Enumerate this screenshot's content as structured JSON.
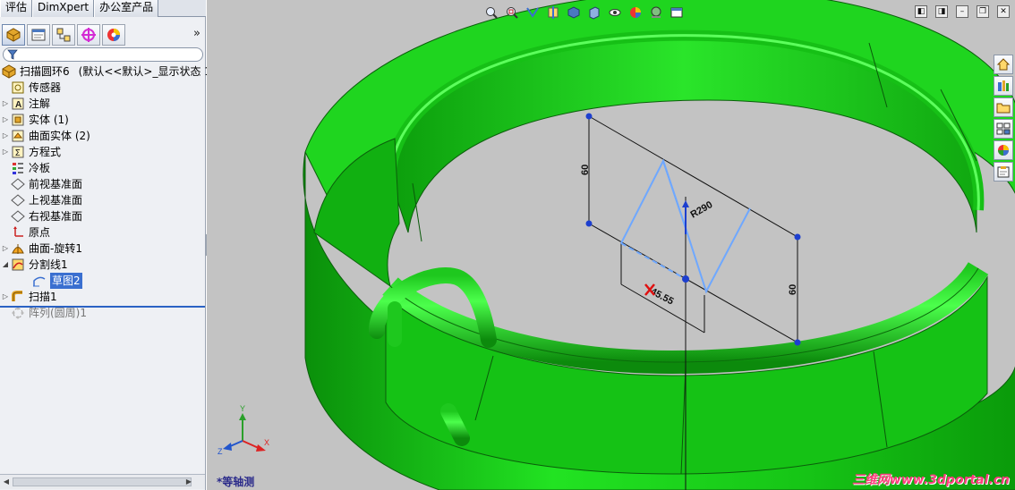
{
  "command_tabs": [
    "评估",
    "DimXpert",
    "办公室产品"
  ],
  "property_manager_tabs": [
    {
      "icon": "feature-manager-icon",
      "active": true
    },
    {
      "icon": "property-manager-icon",
      "active": false
    },
    {
      "icon": "configuration-manager-icon",
      "active": false
    },
    {
      "icon": "dimxpert-manager-icon",
      "active": false
    },
    {
      "icon": "display-manager-icon",
      "active": false
    }
  ],
  "tree": {
    "root": {
      "label": "扫描圆环6",
      "config": "(默认<<默认>_显示状态 1"
    },
    "items": [
      {
        "label": "传感器",
        "icon": "sensor-icon",
        "expandable": false
      },
      {
        "label": "注解",
        "icon": "annotation-icon",
        "expandable": true
      },
      {
        "label": "实体 (1)",
        "icon": "solid-body-icon",
        "expandable": true
      },
      {
        "label": "曲面实体 (2)",
        "icon": "surface-body-icon",
        "expandable": true
      },
      {
        "label": "方程式",
        "icon": "equation-icon",
        "expandable": true
      },
      {
        "label": "冷板",
        "icon": "material-icon",
        "expandable": false
      },
      {
        "label": "前视基准面",
        "icon": "plane-icon",
        "expandable": false
      },
      {
        "label": "上视基准面",
        "icon": "plane-icon",
        "expandable": false
      },
      {
        "label": "右视基准面",
        "icon": "plane-icon",
        "expandable": false
      },
      {
        "label": "原点",
        "icon": "origin-icon",
        "expandable": false
      },
      {
        "label": "曲面-旋转1",
        "icon": "revolve-surface-icon",
        "expandable": true
      },
      {
        "label": "分割线1",
        "icon": "split-line-icon",
        "expandable": true,
        "expanded": true
      },
      {
        "label": "草图2",
        "icon": "sketch-icon",
        "child": true,
        "selected": true
      },
      {
        "label": "扫描1",
        "icon": "sweep-icon",
        "expandable": true
      },
      {
        "label": "阵列(圆周)1",
        "icon": "circular-pattern-icon",
        "expandable": false,
        "grayed": true
      }
    ]
  },
  "viewport": {
    "view_name": "*等轴测",
    "watermark": "三维网www.3dportal.cn",
    "dimensions": [
      "60",
      "60",
      "R290",
      "45.55"
    ],
    "heads_up_toolbar": [
      "zoom-to-fit-icon",
      "zoom-to-area-icon",
      "previous-view-icon",
      "section-view-icon",
      "view-orientation-icon",
      "display-style-icon",
      "hide-show-items-icon",
      "edit-appearance-icon",
      "apply-scene-icon",
      "view-settings-icon"
    ],
    "window_controls": [
      "tile-left",
      "tile-right",
      "minimize",
      "restore",
      "close"
    ],
    "task_pane": [
      "solidworks-resources-icon",
      "design-library-icon",
      "file-explorer-icon",
      "view-palette-icon",
      "appearances-icon",
      "custom-properties-icon"
    ]
  },
  "colors": {
    "part_green": "#19d619",
    "background": "#c3c3c3",
    "sketch_blue": "#6fa8ff",
    "selection_blue": "#3a6fd0"
  }
}
